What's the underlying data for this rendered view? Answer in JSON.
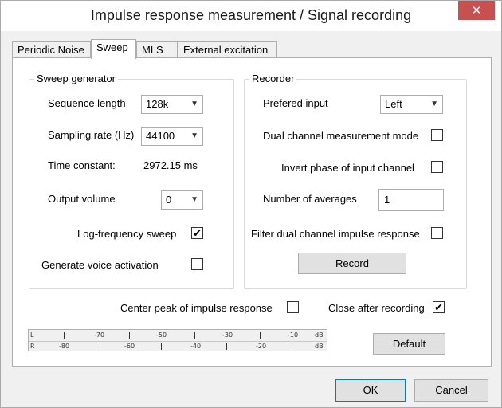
{
  "window": {
    "title": "Impulse response measurement / Signal recording",
    "close_label": "✕"
  },
  "tabs": [
    {
      "label": "Periodic Noise"
    },
    {
      "label": "Sweep"
    },
    {
      "label": "MLS"
    },
    {
      "label": "External excitation"
    }
  ],
  "sweep_generator": {
    "title": "Sweep generator",
    "sequence_length_label": "Sequence length",
    "sequence_length_value": "128k",
    "sampling_rate_label": "Sampling rate (Hz)",
    "sampling_rate_value": "44100",
    "time_constant_label": "Time constant:",
    "time_constant_value": "2972.15 ms",
    "output_volume_label": "Output volume",
    "output_volume_value": "0",
    "log_frequency_label": "Log-frequency sweep",
    "log_frequency_checked": true,
    "voice_activation_label": "Generate voice activation",
    "voice_activation_checked": false
  },
  "recorder": {
    "title": "Recorder",
    "prefered_input_label": "Prefered input",
    "prefered_input_value": "Left",
    "dual_channel_label": "Dual channel measurement mode",
    "dual_channel_checked": false,
    "invert_phase_label": "Invert phase of input channel",
    "invert_phase_checked": false,
    "averages_label": "Number of averages",
    "averages_value": "1",
    "filter_dual_label": "Filter dual channel impulse response",
    "filter_dual_checked": false,
    "record_label": "Record"
  },
  "options": {
    "center_peak_label": "Center peak of impulse response",
    "center_peak_checked": false,
    "close_after_label": "Close after recording",
    "close_after_checked": true
  },
  "meter": {
    "row_l": {
      "channel": "L",
      "labels": [
        "-70",
        "-50",
        "-30",
        "-10"
      ],
      "unit": "dB"
    },
    "row_r": {
      "channel": "R",
      "labels": [
        "-80",
        "-60",
        "-40",
        "-20"
      ],
      "unit": "dB"
    }
  },
  "buttons": {
    "default_label": "Default",
    "ok_label": "OK",
    "cancel_label": "Cancel"
  },
  "checkmark": "✔"
}
